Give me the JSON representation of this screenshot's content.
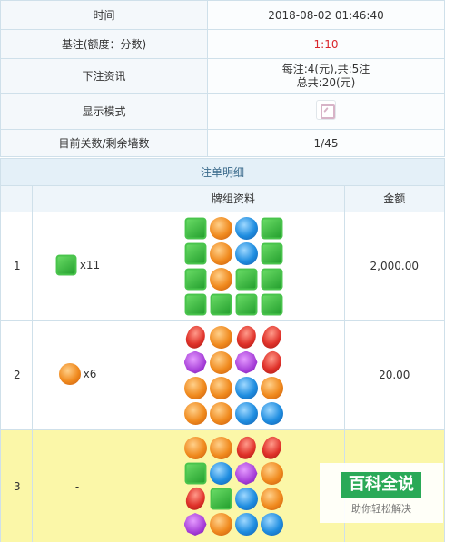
{
  "info": {
    "rows": [
      {
        "label": "时间",
        "value": "2018-08-02 01:46:40"
      },
      {
        "label": "基注(额度：分数)",
        "value": "1:10"
      },
      {
        "label": "下注资讯",
        "value_line1": "每注:4(元),共:5注",
        "value_line2": "总共:20(元)"
      },
      {
        "label": "显示模式"
      },
      {
        "label": "目前关数/剩余墙数",
        "value": "1/45"
      }
    ]
  },
  "detail": {
    "title": "注单明细",
    "headers": {
      "col2": "牌组资料",
      "col3": "金额"
    },
    "rows": [
      {
        "index": "1",
        "bet_icon": "green-square-candy",
        "bet": "x11",
        "amount": "2,000.00",
        "cards": [
          [
            "square",
            "orange",
            "blue",
            "square"
          ],
          [
            "square",
            "orange",
            "blue",
            "square"
          ],
          [
            "square",
            "orange",
            "square",
            "square"
          ],
          [
            "square",
            "square",
            "square",
            "square"
          ]
        ]
      },
      {
        "index": "2",
        "bet_icon": "orange-round-candy",
        "bet": "x6",
        "amount": "20.00",
        "cards": [
          [
            "red",
            "orange",
            "red",
            "red"
          ],
          [
            "purple",
            "orange",
            "purple",
            "red"
          ],
          [
            "orange",
            "orange",
            "blue",
            "orange"
          ],
          [
            "orange",
            "orange",
            "blue",
            "blue"
          ]
        ]
      },
      {
        "index": "3",
        "bet": "-",
        "amount": "",
        "cards": [
          [
            "orange",
            "orange",
            "red",
            "red"
          ],
          [
            "square",
            "blue",
            "purple",
            "orange"
          ],
          [
            "red",
            "square",
            "blue",
            "orange"
          ],
          [
            "purple",
            "orange",
            "blue",
            "blue"
          ]
        ]
      }
    ]
  },
  "watermark": {
    "title": "百科全说",
    "subtitle": "助你轻松解决"
  }
}
